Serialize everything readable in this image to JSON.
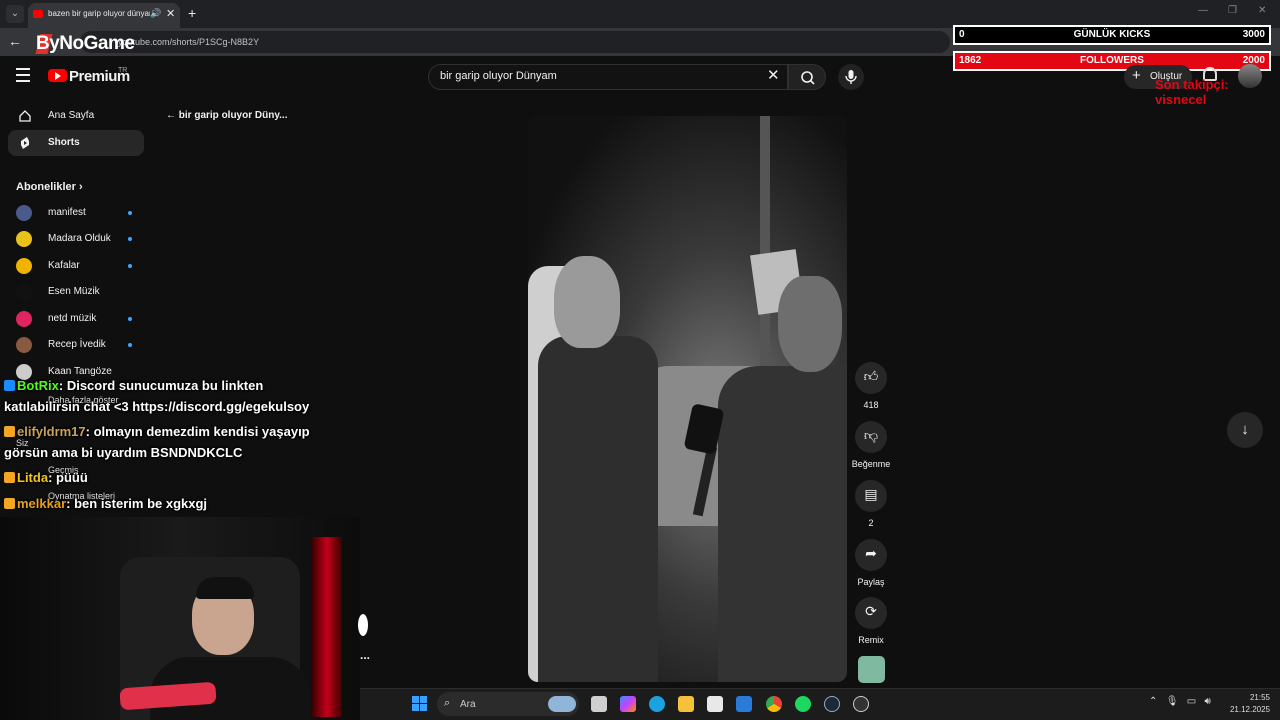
{
  "browser": {
    "tab_title": "bazen bir garip oluyor dünyam",
    "url": "youtube.com/shorts/P1SCg-N8B2Y",
    "new_tab_icon": "plus-icon"
  },
  "overlay": {
    "logo_text": "ByNoGame",
    "kicks": {
      "current": "0",
      "label": "GÜNLÜK KICKS",
      "goal": "3000"
    },
    "followers": {
      "current": "1862",
      "label": "FOLLOWERS",
      "goal": "2000"
    },
    "last_follower": "Son takipçi: visnecel"
  },
  "youtube": {
    "brand": "Premium",
    "region": "TR",
    "search_value": "bir garip oluyor Dünyam",
    "create_label": "Oluştur",
    "back_label": "bir garip oluyor Düny...",
    "sidebar": {
      "home": "Ana Sayfa",
      "shorts": "Shorts",
      "subs_title": "Abonelikler",
      "subscriptions": [
        {
          "name": "manifest",
          "color": "#4a5a8a"
        },
        {
          "name": "Madara Olduk",
          "color": "#e8c21a"
        },
        {
          "name": "Kafalar",
          "color": "#f0b400"
        },
        {
          "name": "Esen Müzik",
          "color": "#111111"
        },
        {
          "name": "netd müzik",
          "color": "#e0245e"
        },
        {
          "name": "Recep İvedik",
          "color": "#8a5a40"
        },
        {
          "name": "Kaan Tangöze",
          "color": "#cccccc"
        }
      ],
      "show_more": "Daha fazla göster",
      "you": "Siz",
      "history": "Geçmiş",
      "playlists": "Oynatma listeleri"
    },
    "actions": {
      "likes": "418",
      "dislike": "Beğenme",
      "comments": "2",
      "share": "Paylaş",
      "remix": "Remix"
    }
  },
  "chat": [
    {
      "name": "BotRix",
      "name_color": "#53fc18",
      "text": ": Discord sunucumuza bu linkten",
      "line2": "katılabilirsin chat <3 https://discord.gg/egekulsoy"
    },
    {
      "name": "elifyldrm17",
      "name_color": "#c8a25a",
      "text": ": olmayın demezdim kendisi yaşayıp",
      "line2": "görsün ama bi uyardım BSNDNDKCLC"
    },
    {
      "name": "Litda",
      "name_color": "#f5c518",
      "text": ": püüü"
    },
    {
      "name": "melkkar",
      "name_color": "#e8a020",
      "text": ": ben isterim be xgkxgj"
    }
  ],
  "webcam": {
    "overflow_text": "..."
  },
  "taskbar": {
    "search_placeholder": "Ara",
    "time": "21:55",
    "date": "21.12.2025"
  },
  "colors": {
    "accent_red": "#ff0000",
    "follower_bar": "#e30613",
    "link_blue": "#3ea6ff"
  }
}
